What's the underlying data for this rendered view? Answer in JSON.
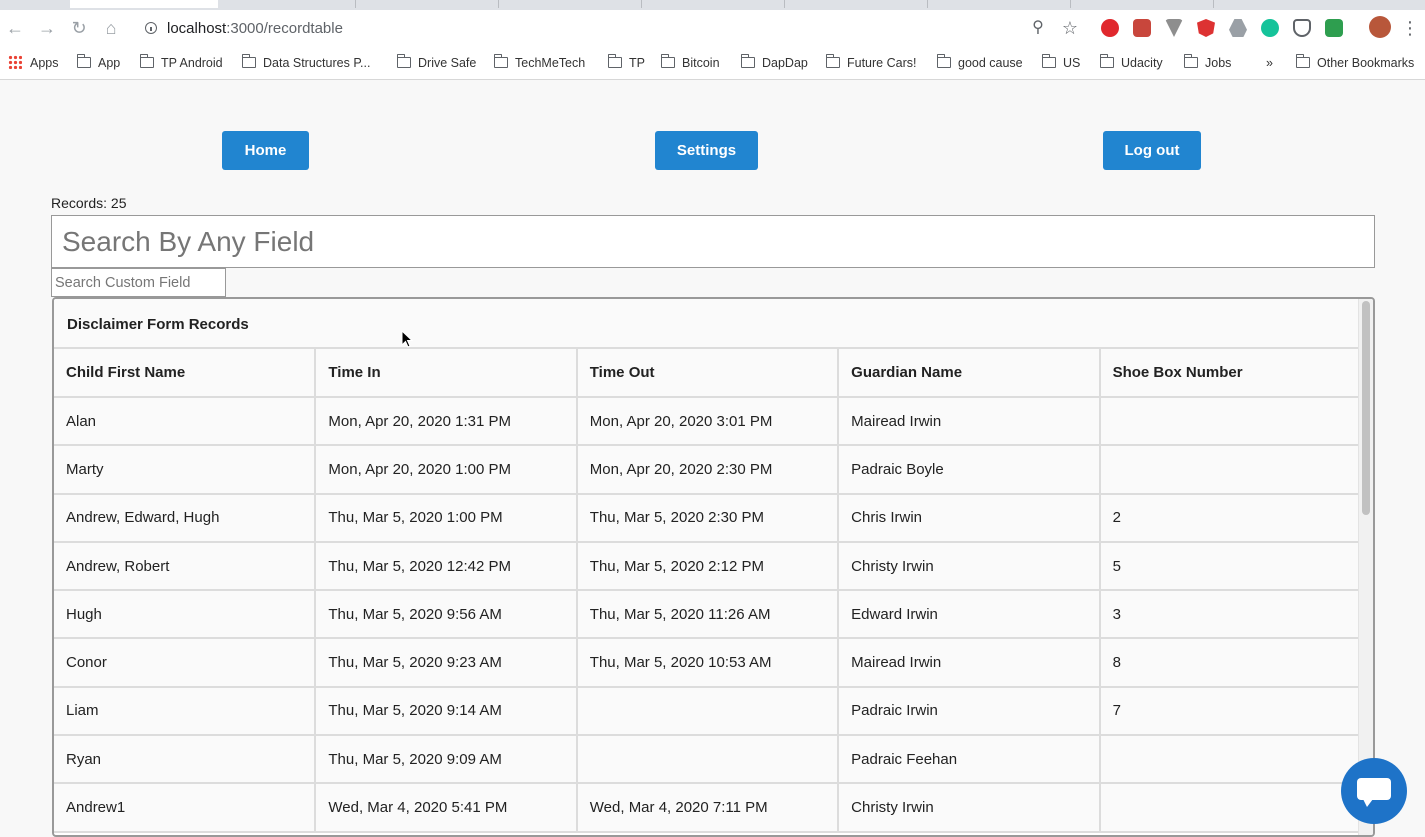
{
  "browser": {
    "url_host": "localhost",
    "url_path": ":3000/recordtable",
    "bookmarks": [
      "Apps",
      "App",
      "TP Android",
      "Data Structures P...",
      "Drive Safe",
      "TechMeTech",
      "TP",
      "Bitcoin",
      "DapDap",
      "Future Cars!",
      "good cause",
      "US",
      "Udacity",
      "Jobs"
    ],
    "more_bookmarks": "»",
    "other_bookmarks": "Other Bookmarks"
  },
  "nav": {
    "home_label": "Home",
    "settings_label": "Settings",
    "logout_label": "Log out"
  },
  "records_label": "Records: 25",
  "search": {
    "main_placeholder": "Search By Any Field",
    "custom_placeholder": "Search Custom Field"
  },
  "table": {
    "caption": "Disclaimer Form Records",
    "columns": [
      "Child First Name",
      "Time In",
      "Time Out",
      "Guardian Name",
      "Shoe Box Number"
    ],
    "rows": [
      [
        "Alan",
        "Mon, Apr 20, 2020 1:31 PM",
        "Mon, Apr 20, 2020 3:01 PM",
        "Mairead Irwin",
        ""
      ],
      [
        "Marty",
        "Mon, Apr 20, 2020 1:00 PM",
        "Mon, Apr 20, 2020 2:30 PM",
        "Padraic Boyle",
        ""
      ],
      [
        "Andrew, Edward, Hugh",
        "Thu, Mar 5, 2020 1:00 PM",
        "Thu, Mar 5, 2020 2:30 PM",
        "Chris Irwin",
        "2"
      ],
      [
        "Andrew, Robert",
        "Thu, Mar 5, 2020 12:42 PM",
        "Thu, Mar 5, 2020 2:12 PM",
        "Christy Irwin",
        "5"
      ],
      [
        "Hugh",
        "Thu, Mar 5, 2020 9:56 AM",
        "Thu, Mar 5, 2020 11:26 AM",
        "Edward Irwin",
        "3"
      ],
      [
        "Conor",
        "Thu, Mar 5, 2020 9:23 AM",
        "Thu, Mar 5, 2020 10:53 AM",
        "Mairead Irwin",
        "8"
      ],
      [
        "Liam",
        "Thu, Mar 5, 2020 9:14 AM",
        "",
        "Padraic Irwin",
        "7"
      ],
      [
        "Ryan",
        "Thu, Mar 5, 2020 9:09 AM",
        "",
        "Padraic Feehan",
        ""
      ],
      [
        "Andrew1",
        "Wed, Mar 4, 2020 5:41 PM",
        "Wed, Mar 4, 2020 7:11 PM",
        "Christy Irwin",
        ""
      ]
    ]
  },
  "colors": {
    "primary_button": "#2185d0",
    "chat_bubble": "#1e73c8"
  },
  "icons": [
    "back-icon",
    "forward-icon",
    "reload-icon",
    "home-icon",
    "info-icon",
    "zoom-icon",
    "star-icon",
    "apps-grid-icon",
    "folder-icon",
    "cursor-icon",
    "chat-icon"
  ]
}
